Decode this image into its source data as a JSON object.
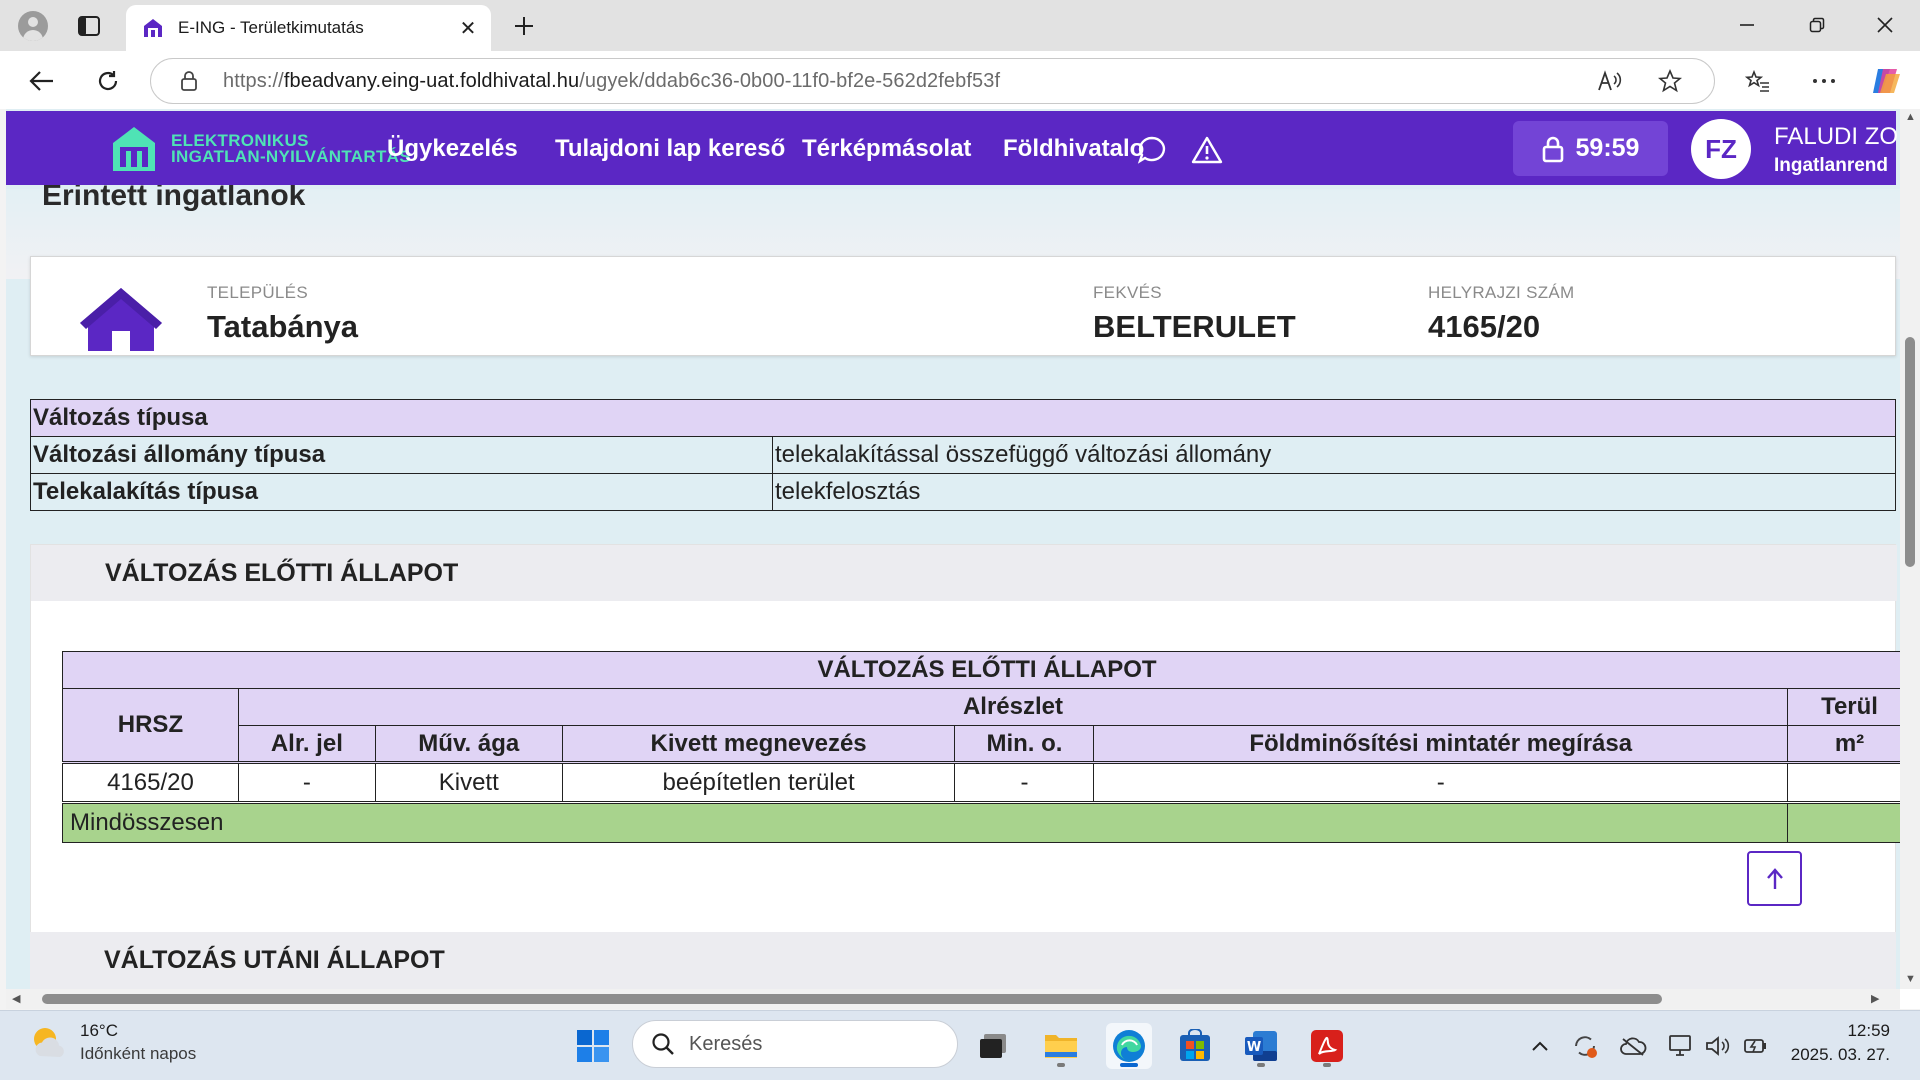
{
  "browser": {
    "tab_title": "E-ING - Területkimutatás",
    "url_prefix": "https://",
    "url_host": "fbeadvany.eing-uat.foldhivatal.hu",
    "url_path": "/ugyek/ddab6c36-0b00-11f0-bf2e-562d2febf53f"
  },
  "app": {
    "logo_line1": "ELEKTRONIKUS",
    "logo_line2": "INGATLAN-NYILVÁNTARTÁS",
    "nav": [
      "Ügykezelés",
      "Tulajdoni lap kereső",
      "Térképmásolat",
      "Földhivatalo"
    ],
    "timer": "59:59",
    "avatar_initials": "FZ",
    "user_name": "FALUDI ZO",
    "user_role": "Ingatlanrend",
    "brand_color": "#5b27c4"
  },
  "page": {
    "section_title": "Érintett ingatlanok",
    "property": {
      "settlement_label": "TELEPÜLÉS",
      "settlement_value": "Tatabánya",
      "location_label": "FEKVÉS",
      "location_value": "BELTERULET",
      "parcel_label": "HELYRAJZI SZÁM",
      "parcel_value": "4165/20"
    },
    "change_info": {
      "header": "Változás típusa",
      "rows": [
        {
          "label": "Változási állomány típusa",
          "value": "telekalakítással összefüggő változási állomány"
        },
        {
          "label": "Telekalakítás típusa",
          "value": "telekfelosztás"
        }
      ]
    },
    "before": {
      "section_heading": "VÁLTOZÁS ELŐTTI ÁLLAPOT",
      "table_title": "VÁLTOZÁS ELŐTTI ÁLLAPOT",
      "col_hrsz": "HRSZ",
      "group_subdivision": "Alrészlet",
      "col_area": "Terül",
      "col_area_unit": "m²",
      "subcolumns": [
        "Alr. jel",
        "Műv. ága",
        "Kivett megnevezés",
        "Min. o.",
        "Földminősítési mintatér megírása"
      ],
      "rows": [
        {
          "hrsz": "4165/20",
          "alr_jel": "-",
          "muv_aga": "Kivett",
          "kivett": "beépítetlen terület",
          "min_o": "-",
          "mintater": "-",
          "area": ""
        }
      ],
      "total_label": "Mindösszesen",
      "total_color": "#a8d38d"
    },
    "after": {
      "section_heading": "VÁLTOZÁS UTÁNI ÁLLAPOT"
    }
  },
  "taskbar": {
    "weather_temp": "16°C",
    "weather_desc": "Időnként napos",
    "search_placeholder": "Keresés",
    "time": "12:59",
    "date": "2025. 03. 27."
  }
}
